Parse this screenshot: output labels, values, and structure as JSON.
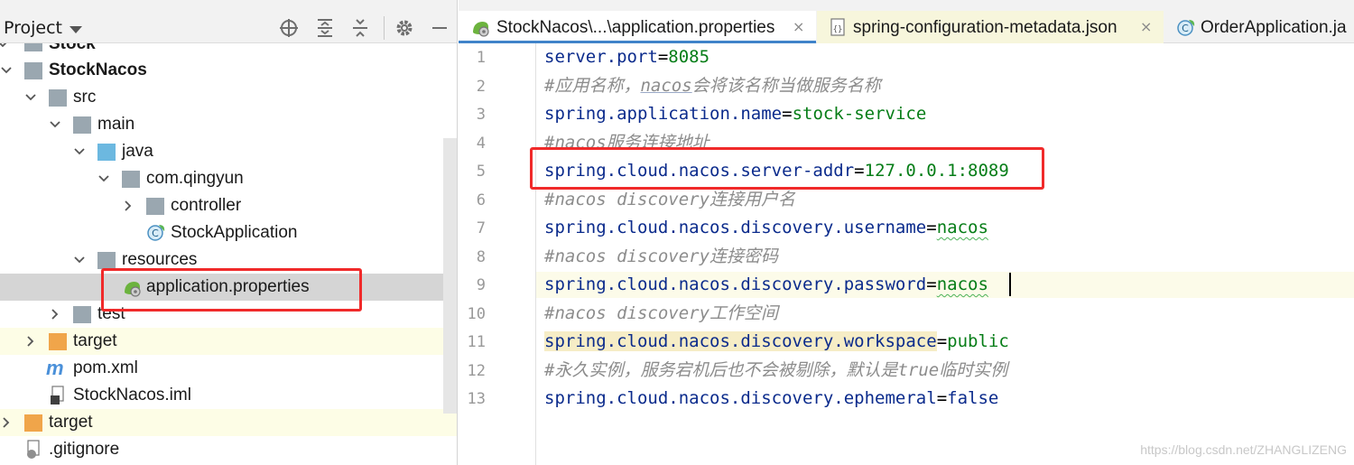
{
  "project_panel": {
    "title": "Project",
    "tree": [
      {
        "label": "Stock",
        "bold": true
      },
      {
        "label": "StockNacos",
        "bold": true
      },
      {
        "label": "src"
      },
      {
        "label": "main"
      },
      {
        "label": "java"
      },
      {
        "label": "com.qingyun"
      },
      {
        "label": "controller"
      },
      {
        "label": "StockApplication"
      },
      {
        "label": "resources"
      },
      {
        "label": "application.properties"
      },
      {
        "label": "test"
      },
      {
        "label": "target"
      },
      {
        "label": "pom.xml"
      },
      {
        "label": "StockNacos.iml"
      },
      {
        "label": "target"
      },
      {
        "label": ".gitignore"
      }
    ]
  },
  "editor": {
    "tabs": [
      {
        "label": "StockNacos\\...\\application.properties",
        "close": "×"
      },
      {
        "label": "spring-configuration-metadata.json",
        "close": "×"
      },
      {
        "label": "OrderApplication.ja"
      }
    ],
    "lines": [
      {
        "num": "1",
        "key": "server.port",
        "eq": "=",
        "value": "8085"
      },
      {
        "num": "2",
        "comment_a": "#应用名称，",
        "comment_b": "nacos",
        "comment_c": "会将该名称当做服务名称"
      },
      {
        "num": "3",
        "key": "spring.application.name",
        "eq": "=",
        "value": "stock-service"
      },
      {
        "num": "4",
        "comment": "#nacos服务连接地址"
      },
      {
        "num": "5",
        "key": "spring.cloud.nacos.server-addr",
        "eq": "=",
        "value": "127.0.0.1:8089"
      },
      {
        "num": "6",
        "comment": "#nacos discovery连接用户名"
      },
      {
        "num": "7",
        "key": "spring.cloud.nacos.discovery.username",
        "eq": "=",
        "value": "nacos"
      },
      {
        "num": "8",
        "comment": "#nacos discovery连接密码"
      },
      {
        "num": "9",
        "key": "spring.cloud.nacos.discovery.password",
        "eq": "=",
        "value": "nacos"
      },
      {
        "num": "10",
        "comment": "#nacos discovery工作空间"
      },
      {
        "num": "11",
        "key": "spring.cloud.nacos.discovery.workspace",
        "eq": "=",
        "value": "public"
      },
      {
        "num": "12",
        "comment_a": "#永久实例，服务宕机后也不会被剔除，默认是",
        "comment_b": "true",
        "comment_c": "临时实例"
      },
      {
        "num": "13",
        "key": "spring.cloud.nacos.discovery.ephemeral",
        "eq": "=",
        "value": "false"
      }
    ]
  },
  "watermark": "https://blog.csdn.net/ZHANGLIZENG",
  "colors": {
    "property_key": "#0b2b8c",
    "property_value": "#067d17",
    "comment": "#8c8c8c",
    "annotation_box": "#f02a2a",
    "active_tab_underline": "#4083c9"
  }
}
